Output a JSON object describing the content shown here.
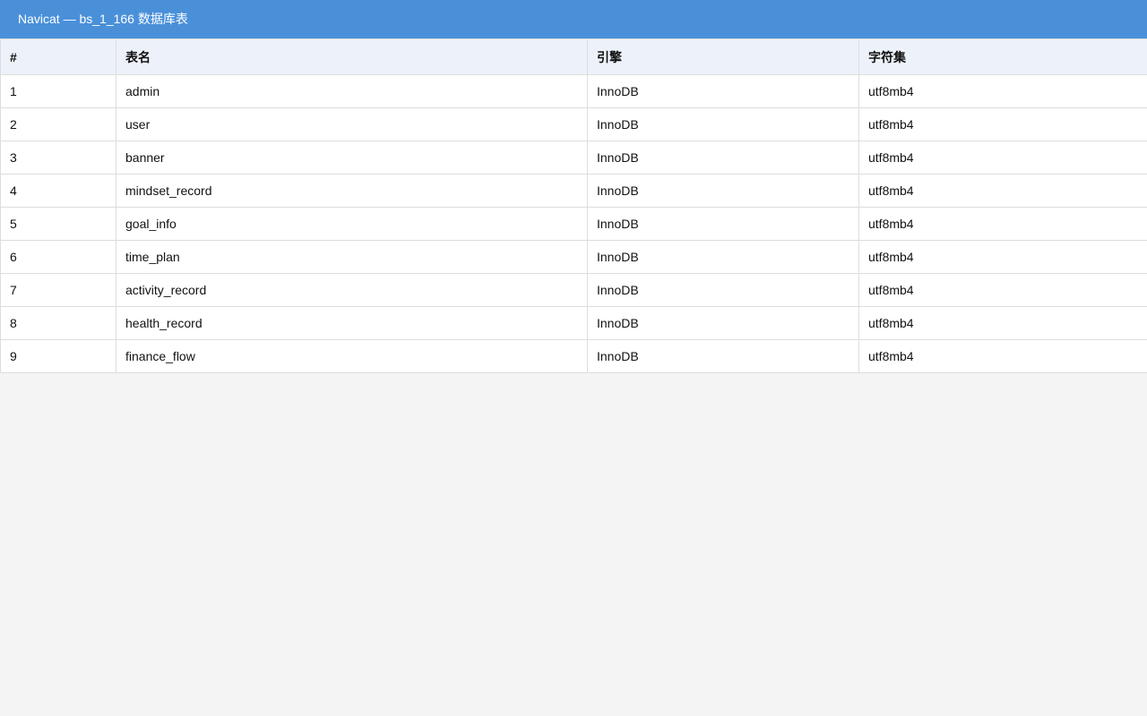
{
  "window": {
    "title": "Navicat — bs_1_166 数据库表"
  },
  "colors": {
    "titlebar": "#4a90d9",
    "header_bg": "#edf2fa",
    "page_bg": "#f4f4f4",
    "border": "#dddddd"
  },
  "table": {
    "headers": [
      "#",
      "表名",
      "引擎",
      "字符集"
    ],
    "rows": [
      [
        "1",
        "admin",
        "InnoDB",
        "utf8mb4"
      ],
      [
        "2",
        "user",
        "InnoDB",
        "utf8mb4"
      ],
      [
        "3",
        "banner",
        "InnoDB",
        "utf8mb4"
      ],
      [
        "4",
        "mindset_record",
        "InnoDB",
        "utf8mb4"
      ],
      [
        "5",
        "goal_info",
        "InnoDB",
        "utf8mb4"
      ],
      [
        "6",
        "time_plan",
        "InnoDB",
        "utf8mb4"
      ],
      [
        "7",
        "activity_record",
        "InnoDB",
        "utf8mb4"
      ],
      [
        "8",
        "health_record",
        "InnoDB",
        "utf8mb4"
      ],
      [
        "9",
        "finance_flow",
        "InnoDB",
        "utf8mb4"
      ]
    ]
  }
}
